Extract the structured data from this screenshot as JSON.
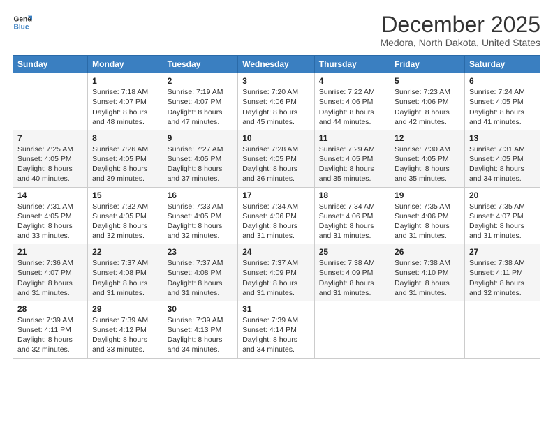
{
  "logo": {
    "line1": "General",
    "line2": "Blue"
  },
  "title": "December 2025",
  "subtitle": "Medora, North Dakota, United States",
  "days_of_week": [
    "Sunday",
    "Monday",
    "Tuesday",
    "Wednesday",
    "Thursday",
    "Friday",
    "Saturday"
  ],
  "weeks": [
    [
      {
        "day": "",
        "sunrise": "",
        "sunset": "",
        "daylight": ""
      },
      {
        "day": "1",
        "sunrise": "Sunrise: 7:18 AM",
        "sunset": "Sunset: 4:07 PM",
        "daylight": "Daylight: 8 hours and 48 minutes."
      },
      {
        "day": "2",
        "sunrise": "Sunrise: 7:19 AM",
        "sunset": "Sunset: 4:07 PM",
        "daylight": "Daylight: 8 hours and 47 minutes."
      },
      {
        "day": "3",
        "sunrise": "Sunrise: 7:20 AM",
        "sunset": "Sunset: 4:06 PM",
        "daylight": "Daylight: 8 hours and 45 minutes."
      },
      {
        "day": "4",
        "sunrise": "Sunrise: 7:22 AM",
        "sunset": "Sunset: 4:06 PM",
        "daylight": "Daylight: 8 hours and 44 minutes."
      },
      {
        "day": "5",
        "sunrise": "Sunrise: 7:23 AM",
        "sunset": "Sunset: 4:06 PM",
        "daylight": "Daylight: 8 hours and 42 minutes."
      },
      {
        "day": "6",
        "sunrise": "Sunrise: 7:24 AM",
        "sunset": "Sunset: 4:05 PM",
        "daylight": "Daylight: 8 hours and 41 minutes."
      }
    ],
    [
      {
        "day": "7",
        "sunrise": "Sunrise: 7:25 AM",
        "sunset": "Sunset: 4:05 PM",
        "daylight": "Daylight: 8 hours and 40 minutes."
      },
      {
        "day": "8",
        "sunrise": "Sunrise: 7:26 AM",
        "sunset": "Sunset: 4:05 PM",
        "daylight": "Daylight: 8 hours and 39 minutes."
      },
      {
        "day": "9",
        "sunrise": "Sunrise: 7:27 AM",
        "sunset": "Sunset: 4:05 PM",
        "daylight": "Daylight: 8 hours and 37 minutes."
      },
      {
        "day": "10",
        "sunrise": "Sunrise: 7:28 AM",
        "sunset": "Sunset: 4:05 PM",
        "daylight": "Daylight: 8 hours and 36 minutes."
      },
      {
        "day": "11",
        "sunrise": "Sunrise: 7:29 AM",
        "sunset": "Sunset: 4:05 PM",
        "daylight": "Daylight: 8 hours and 35 minutes."
      },
      {
        "day": "12",
        "sunrise": "Sunrise: 7:30 AM",
        "sunset": "Sunset: 4:05 PM",
        "daylight": "Daylight: 8 hours and 35 minutes."
      },
      {
        "day": "13",
        "sunrise": "Sunrise: 7:31 AM",
        "sunset": "Sunset: 4:05 PM",
        "daylight": "Daylight: 8 hours and 34 minutes."
      }
    ],
    [
      {
        "day": "14",
        "sunrise": "Sunrise: 7:31 AM",
        "sunset": "Sunset: 4:05 PM",
        "daylight": "Daylight: 8 hours and 33 minutes."
      },
      {
        "day": "15",
        "sunrise": "Sunrise: 7:32 AM",
        "sunset": "Sunset: 4:05 PM",
        "daylight": "Daylight: 8 hours and 32 minutes."
      },
      {
        "day": "16",
        "sunrise": "Sunrise: 7:33 AM",
        "sunset": "Sunset: 4:05 PM",
        "daylight": "Daylight: 8 hours and 32 minutes."
      },
      {
        "day": "17",
        "sunrise": "Sunrise: 7:34 AM",
        "sunset": "Sunset: 4:06 PM",
        "daylight": "Daylight: 8 hours and 31 minutes."
      },
      {
        "day": "18",
        "sunrise": "Sunrise: 7:34 AM",
        "sunset": "Sunset: 4:06 PM",
        "daylight": "Daylight: 8 hours and 31 minutes."
      },
      {
        "day": "19",
        "sunrise": "Sunrise: 7:35 AM",
        "sunset": "Sunset: 4:06 PM",
        "daylight": "Daylight: 8 hours and 31 minutes."
      },
      {
        "day": "20",
        "sunrise": "Sunrise: 7:35 AM",
        "sunset": "Sunset: 4:07 PM",
        "daylight": "Daylight: 8 hours and 31 minutes."
      }
    ],
    [
      {
        "day": "21",
        "sunrise": "Sunrise: 7:36 AM",
        "sunset": "Sunset: 4:07 PM",
        "daylight": "Daylight: 8 hours and 31 minutes."
      },
      {
        "day": "22",
        "sunrise": "Sunrise: 7:37 AM",
        "sunset": "Sunset: 4:08 PM",
        "daylight": "Daylight: 8 hours and 31 minutes."
      },
      {
        "day": "23",
        "sunrise": "Sunrise: 7:37 AM",
        "sunset": "Sunset: 4:08 PM",
        "daylight": "Daylight: 8 hours and 31 minutes."
      },
      {
        "day": "24",
        "sunrise": "Sunrise: 7:37 AM",
        "sunset": "Sunset: 4:09 PM",
        "daylight": "Daylight: 8 hours and 31 minutes."
      },
      {
        "day": "25",
        "sunrise": "Sunrise: 7:38 AM",
        "sunset": "Sunset: 4:09 PM",
        "daylight": "Daylight: 8 hours and 31 minutes."
      },
      {
        "day": "26",
        "sunrise": "Sunrise: 7:38 AM",
        "sunset": "Sunset: 4:10 PM",
        "daylight": "Daylight: 8 hours and 31 minutes."
      },
      {
        "day": "27",
        "sunrise": "Sunrise: 7:38 AM",
        "sunset": "Sunset: 4:11 PM",
        "daylight": "Daylight: 8 hours and 32 minutes."
      }
    ],
    [
      {
        "day": "28",
        "sunrise": "Sunrise: 7:39 AM",
        "sunset": "Sunset: 4:11 PM",
        "daylight": "Daylight: 8 hours and 32 minutes."
      },
      {
        "day": "29",
        "sunrise": "Sunrise: 7:39 AM",
        "sunset": "Sunset: 4:12 PM",
        "daylight": "Daylight: 8 hours and 33 minutes."
      },
      {
        "day": "30",
        "sunrise": "Sunrise: 7:39 AM",
        "sunset": "Sunset: 4:13 PM",
        "daylight": "Daylight: 8 hours and 34 minutes."
      },
      {
        "day": "31",
        "sunrise": "Sunrise: 7:39 AM",
        "sunset": "Sunset: 4:14 PM",
        "daylight": "Daylight: 8 hours and 34 minutes."
      },
      {
        "day": "",
        "sunrise": "",
        "sunset": "",
        "daylight": ""
      },
      {
        "day": "",
        "sunrise": "",
        "sunset": "",
        "daylight": ""
      },
      {
        "day": "",
        "sunrise": "",
        "sunset": "",
        "daylight": ""
      }
    ]
  ]
}
